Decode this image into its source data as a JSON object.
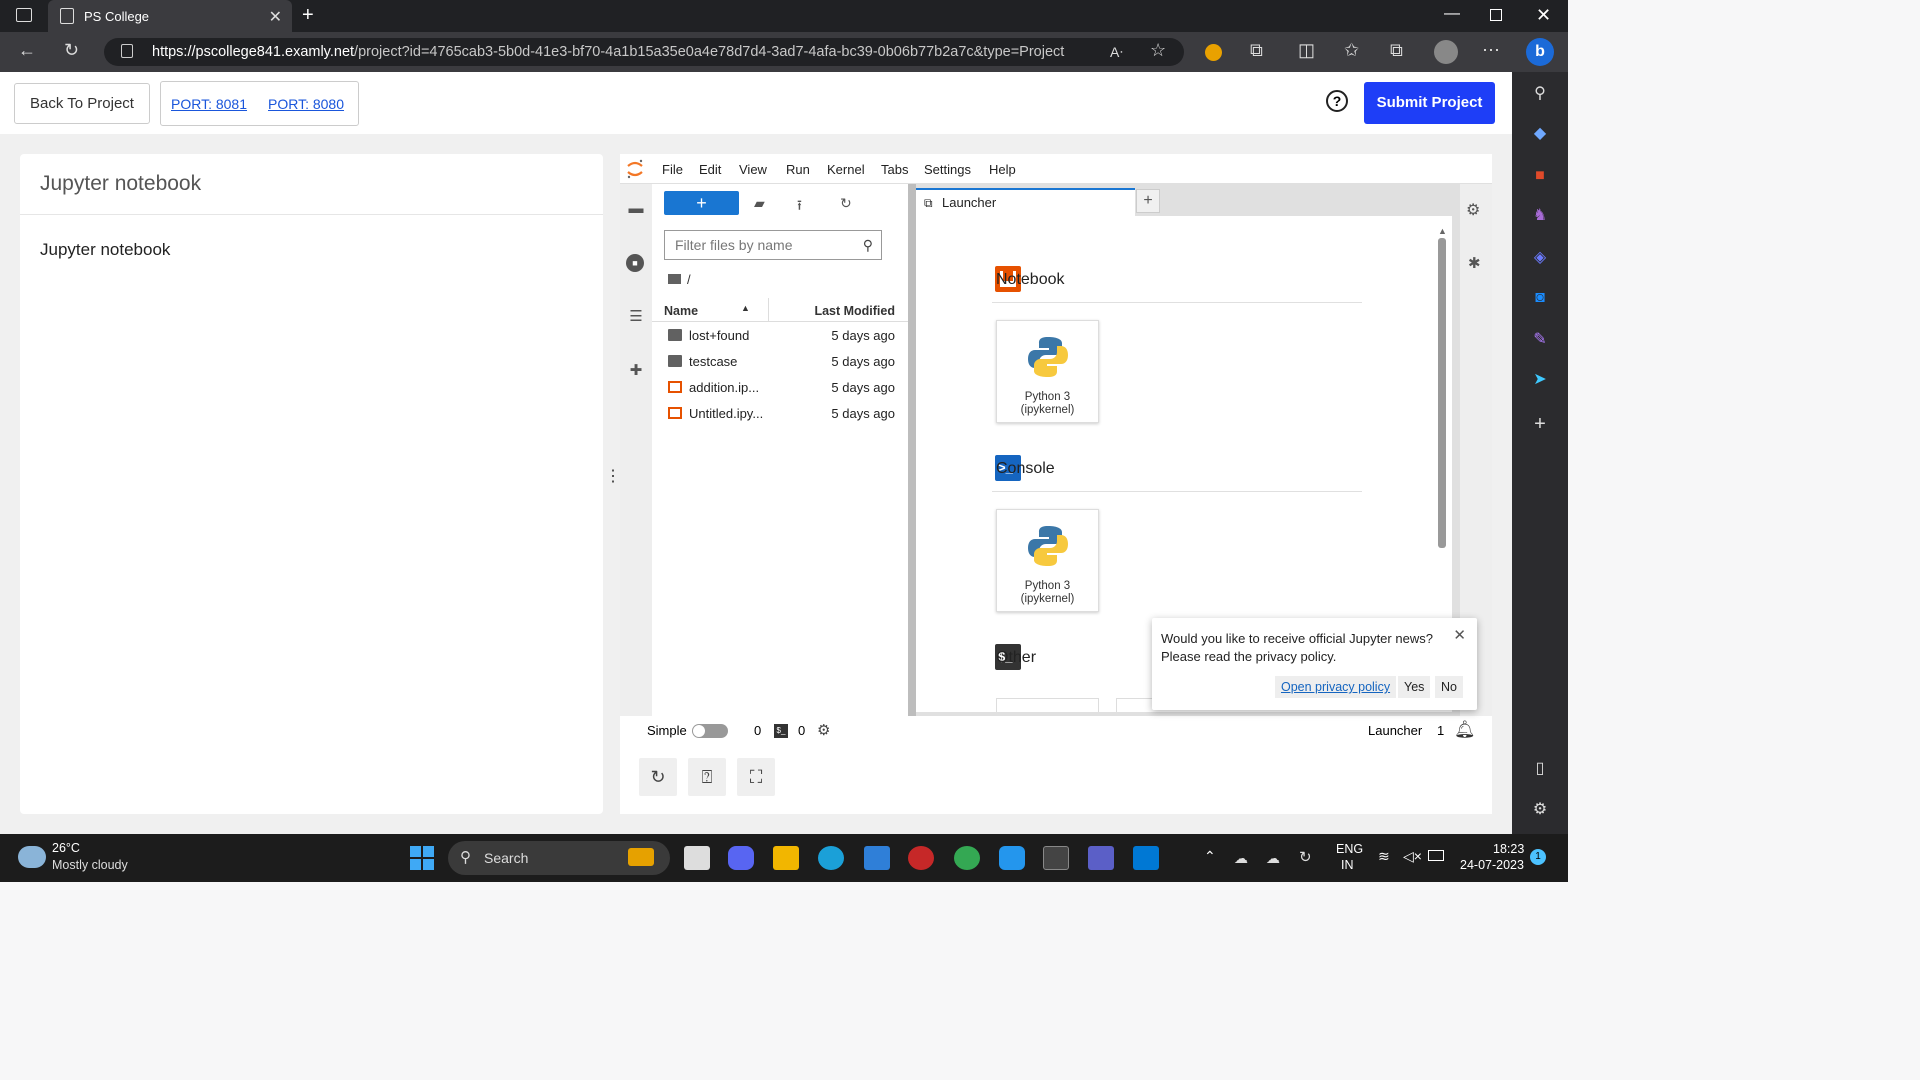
{
  "browser": {
    "tab_title": "PS College",
    "url_host": "https://pscollege841.examly.net",
    "url_path": "/project?id=4765cab3-5b0d-41e3-bf70-4a1b15a35e0a4e78d7d4-3ad7-4afa-bc39-0b06b77b2a7c&type=Project"
  },
  "header": {
    "back_label": "Back To Project",
    "port1": "PORT: 8081",
    "port2": "PORT: 8080",
    "help": "?",
    "submit_label": "Submit Project"
  },
  "left_panel": {
    "title": "Jupyter notebook",
    "body": "Jupyter notebook"
  },
  "jupyter": {
    "menus": [
      "File",
      "Edit",
      "View",
      "Run",
      "Kernel",
      "Tabs",
      "Settings",
      "Help"
    ],
    "filter_placeholder": "Filter files by name",
    "breadcrumb": "/",
    "col_name": "Name",
    "col_modified": "Last Modified",
    "files": [
      {
        "name": "lost+found",
        "type": "folder",
        "modified": "5 days ago"
      },
      {
        "name": "testcase",
        "type": "folder",
        "modified": "5 days ago"
      },
      {
        "name": "addition.ip...",
        "type": "notebook",
        "modified": "5 days ago"
      },
      {
        "name": "Untitled.ipy...",
        "type": "notebook",
        "modified": "5 days ago"
      }
    ],
    "launcher_tab": "Launcher",
    "sections": {
      "notebook": "Notebook",
      "console": "Console",
      "other": "Other"
    },
    "kernel_card_line1": "Python 3",
    "kernel_card_line2": "(ipykernel)",
    "status": {
      "simple": "Simple",
      "kernels": "0",
      "terminals": "0",
      "mode": "Launcher",
      "notifications": "1"
    },
    "toast": {
      "line1": "Would you like to receive official Jupyter news?",
      "line2": "Please read the privacy policy.",
      "link": "Open privacy policy",
      "yes": "Yes",
      "no": "No"
    }
  },
  "taskbar": {
    "temp": "26°C",
    "weather": "Mostly cloudy",
    "search": "Search",
    "lang1": "ENG",
    "lang2": "IN",
    "time": "18:23",
    "date": "24-07-2023",
    "notif_count": "1"
  },
  "colors": {
    "submit": "#1e3ef7",
    "jupyter_blue": "#1976d2",
    "jupyter_orange": "#e65100"
  }
}
